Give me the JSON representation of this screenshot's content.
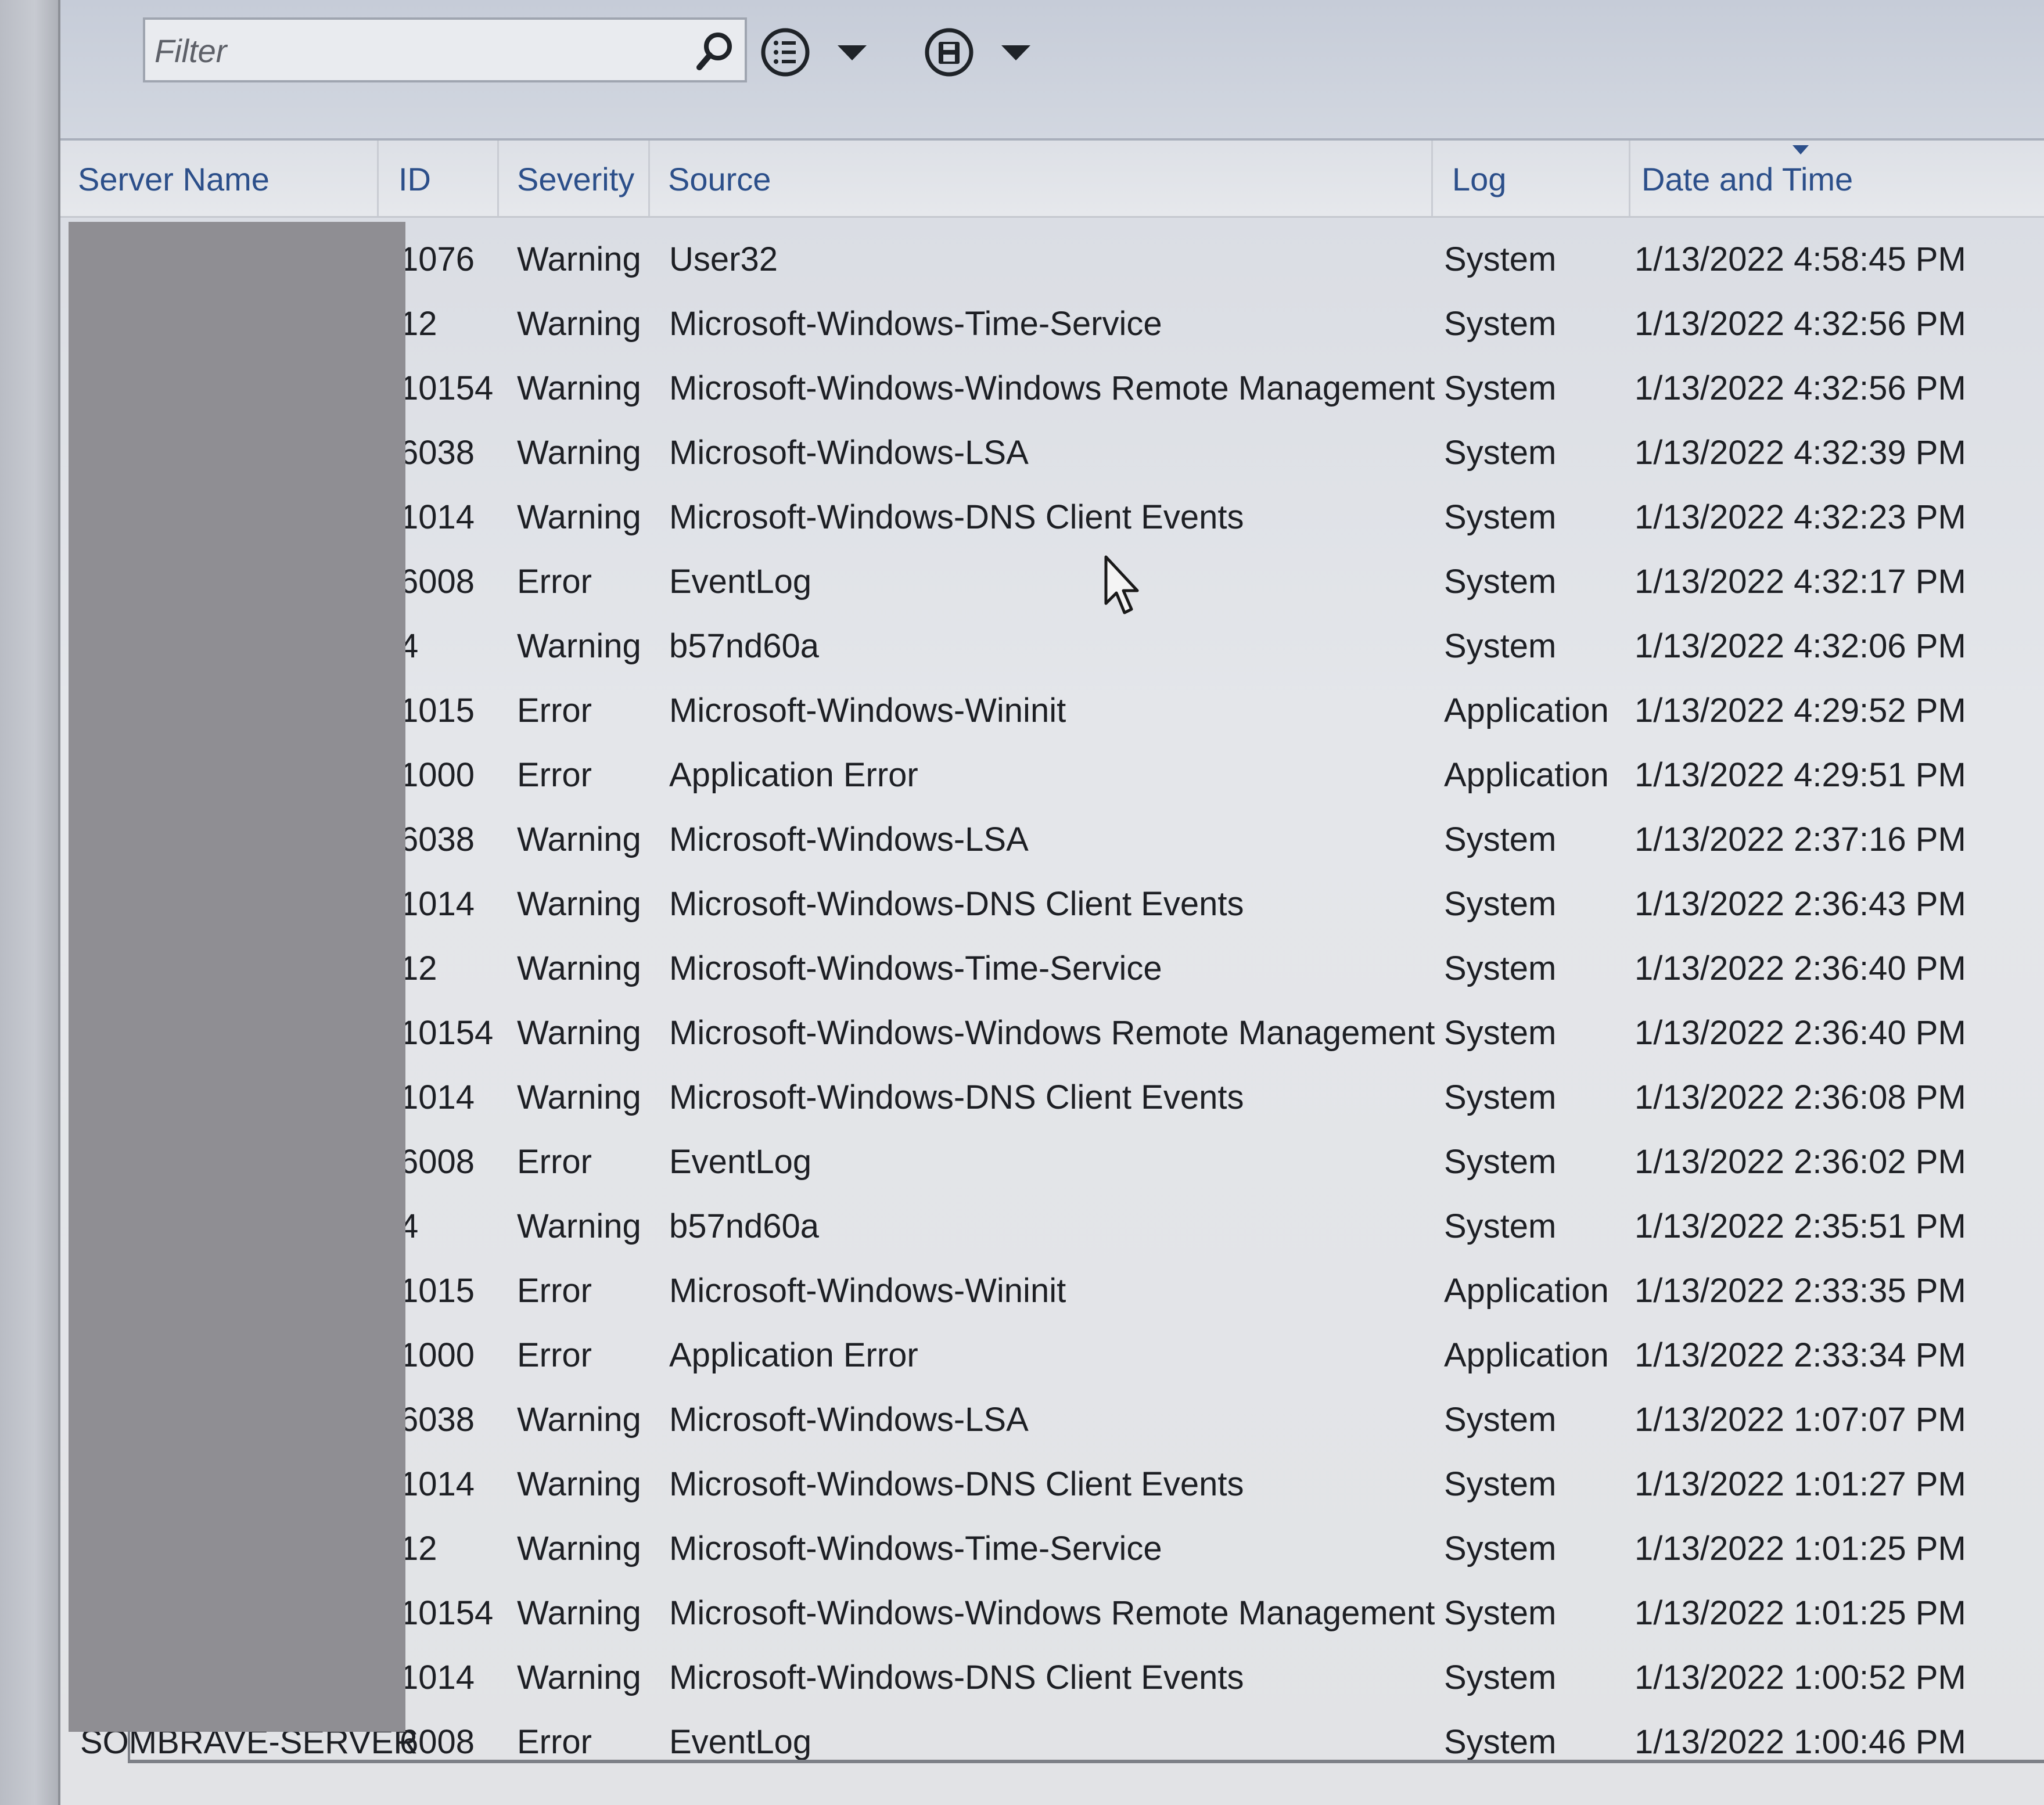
{
  "toolbar": {
    "filter_placeholder": "Filter",
    "search_icon": "search-icon",
    "view_menu_icon": "list-icon",
    "save_menu_icon": "save-icon"
  },
  "table": {
    "columns": [
      "Server Name",
      "ID",
      "Severity",
      "Source",
      "Log",
      "Date and Time"
    ],
    "sorted_column": "Date and Time",
    "sort_direction": "descending",
    "rows": [
      {
        "server": "",
        "id": "1076",
        "severity": "Warning",
        "source": "User32",
        "log": "System",
        "datetime": "1/13/2022 4:58:45 PM"
      },
      {
        "server": "",
        "id": "12",
        "severity": "Warning",
        "source": "Microsoft-Windows-Time-Service",
        "log": "System",
        "datetime": "1/13/2022 4:32:56 PM"
      },
      {
        "server": "",
        "id": "10154",
        "severity": "Warning",
        "source": "Microsoft-Windows-Windows Remote Management",
        "log": "System",
        "datetime": "1/13/2022 4:32:56 PM"
      },
      {
        "server": "",
        "id": "6038",
        "severity": "Warning",
        "source": "Microsoft-Windows-LSA",
        "log": "System",
        "datetime": "1/13/2022 4:32:39 PM"
      },
      {
        "server": "",
        "id": "1014",
        "severity": "Warning",
        "source": "Microsoft-Windows-DNS Client Events",
        "log": "System",
        "datetime": "1/13/2022 4:32:23 PM"
      },
      {
        "server": "",
        "id": "6008",
        "severity": "Error",
        "source": "EventLog",
        "log": "System",
        "datetime": "1/13/2022 4:32:17 PM"
      },
      {
        "server": "",
        "id": "4",
        "severity": "Warning",
        "source": "b57nd60a",
        "log": "System",
        "datetime": "1/13/2022 4:32:06 PM"
      },
      {
        "server": "",
        "id": "1015",
        "severity": "Error",
        "source": "Microsoft-Windows-Wininit",
        "log": "Application",
        "datetime": "1/13/2022 4:29:52 PM"
      },
      {
        "server": "",
        "id": "1000",
        "severity": "Error",
        "source": "Application Error",
        "log": "Application",
        "datetime": "1/13/2022 4:29:51 PM"
      },
      {
        "server": "",
        "id": "6038",
        "severity": "Warning",
        "source": "Microsoft-Windows-LSA",
        "log": "System",
        "datetime": "1/13/2022 2:37:16 PM"
      },
      {
        "server": "",
        "id": "1014",
        "severity": "Warning",
        "source": "Microsoft-Windows-DNS Client Events",
        "log": "System",
        "datetime": "1/13/2022 2:36:43 PM"
      },
      {
        "server": "",
        "id": "12",
        "severity": "Warning",
        "source": "Microsoft-Windows-Time-Service",
        "log": "System",
        "datetime": "1/13/2022 2:36:40 PM"
      },
      {
        "server": "",
        "id": "10154",
        "severity": "Warning",
        "source": "Microsoft-Windows-Windows Remote Management",
        "log": "System",
        "datetime": "1/13/2022 2:36:40 PM"
      },
      {
        "server": "",
        "id": "1014",
        "severity": "Warning",
        "source": "Microsoft-Windows-DNS Client Events",
        "log": "System",
        "datetime": "1/13/2022 2:36:08 PM"
      },
      {
        "server": "",
        "id": "6008",
        "severity": "Error",
        "source": "EventLog",
        "log": "System",
        "datetime": "1/13/2022 2:36:02 PM"
      },
      {
        "server": "",
        "id": "4",
        "severity": "Warning",
        "source": "b57nd60a",
        "log": "System",
        "datetime": "1/13/2022 2:35:51 PM"
      },
      {
        "server": "",
        "id": "1015",
        "severity": "Error",
        "source": "Microsoft-Windows-Wininit",
        "log": "Application",
        "datetime": "1/13/2022 2:33:35 PM"
      },
      {
        "server": "",
        "id": "1000",
        "severity": "Error",
        "source": "Application Error",
        "log": "Application",
        "datetime": "1/13/2022 2:33:34 PM"
      },
      {
        "server": "",
        "id": "6038",
        "severity": "Warning",
        "source": "Microsoft-Windows-LSA",
        "log": "System",
        "datetime": "1/13/2022 1:07:07 PM"
      },
      {
        "server": "",
        "id": "1014",
        "severity": "Warning",
        "source": "Microsoft-Windows-DNS Client Events",
        "log": "System",
        "datetime": "1/13/2022 1:01:27 PM"
      },
      {
        "server": "",
        "id": "12",
        "severity": "Warning",
        "source": "Microsoft-Windows-Time-Service",
        "log": "System",
        "datetime": "1/13/2022 1:01:25 PM"
      },
      {
        "server": "",
        "id": "10154",
        "severity": "Warning",
        "source": "Microsoft-Windows-Windows Remote Management",
        "log": "System",
        "datetime": "1/13/2022 1:01:25 PM"
      },
      {
        "server": "",
        "id": "1014",
        "severity": "Warning",
        "source": "Microsoft-Windows-DNS Client Events",
        "log": "System",
        "datetime": "1/13/2022 1:00:52 PM"
      },
      {
        "server": "SOMBRAVE-SERVER",
        "id": "6008",
        "severity": "Error",
        "source": "EventLog",
        "log": "System",
        "datetime": "1/13/2022 1:00:46 PM"
      }
    ]
  },
  "colors": {
    "header_text": "#2c4f8a",
    "row_text": "#1d1f24",
    "redaction": "#8f8e93"
  }
}
